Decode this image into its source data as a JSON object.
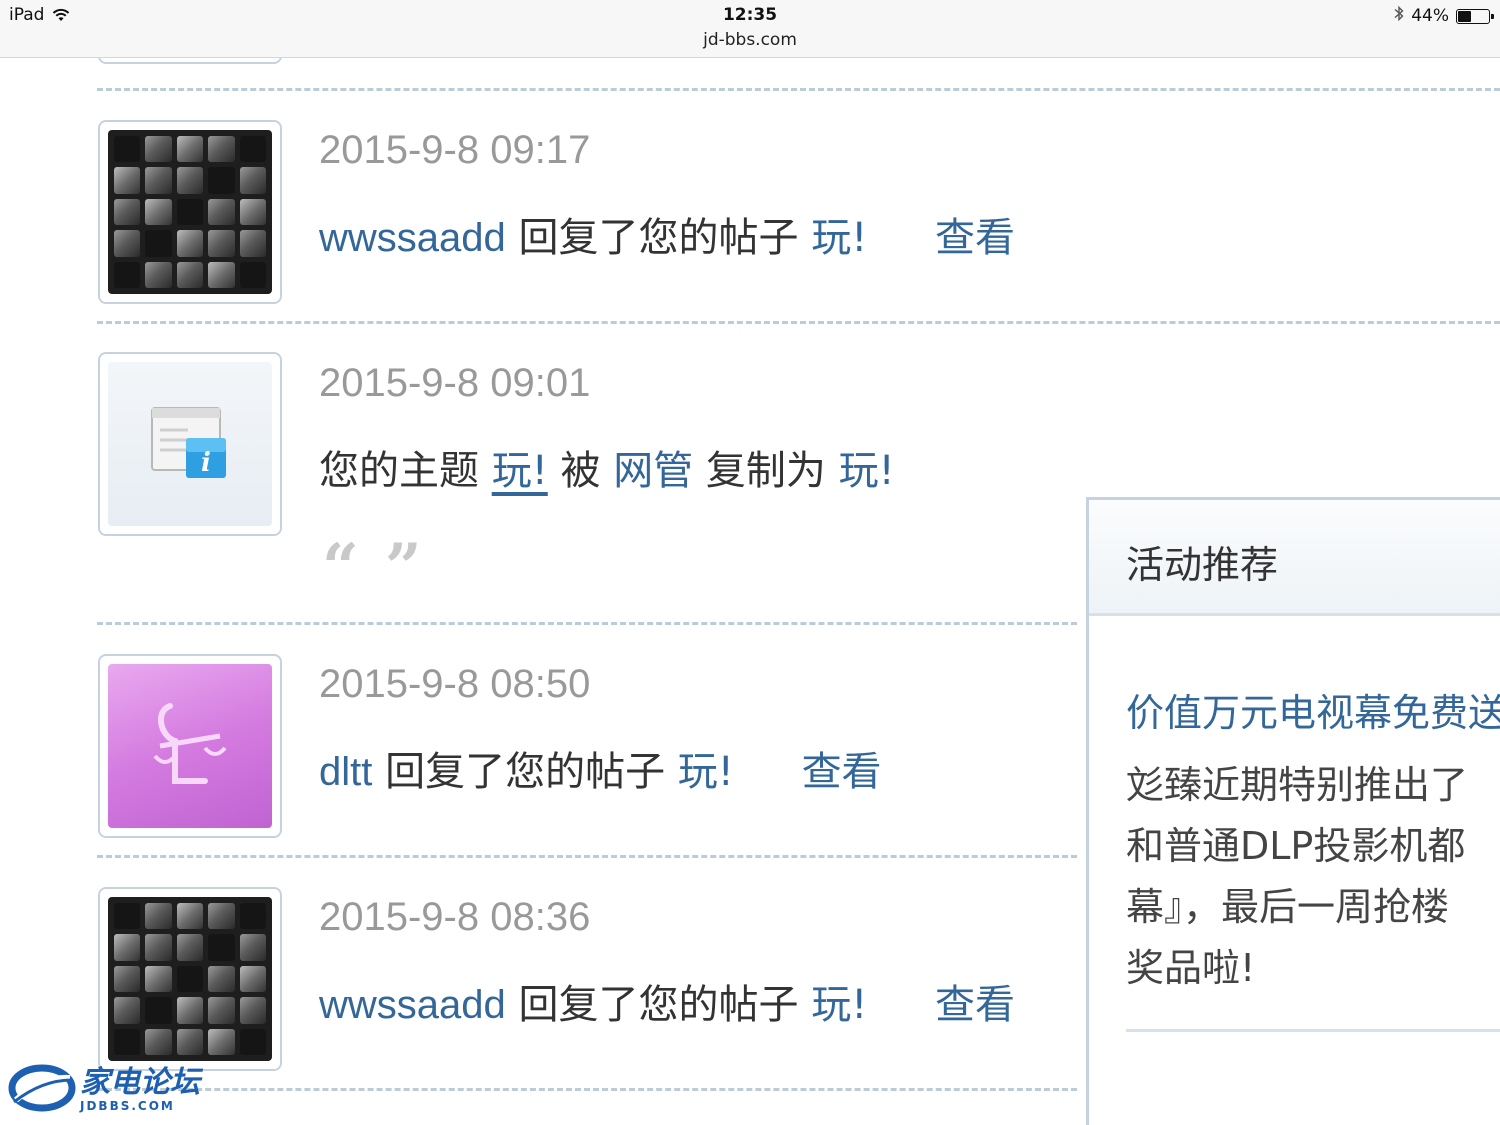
{
  "status_bar": {
    "device": "iPad",
    "time": "12:35",
    "url": "jd-bbs.com",
    "battery_percent": "44%",
    "battery_level": 0.44
  },
  "feed": [
    {
      "avatar": "keyboard-avatar",
      "time": "2015-9-8 09:17",
      "user": "wwssaadd",
      "action": "回复了您的帖子",
      "thread": "玩!",
      "view": "查看"
    },
    {
      "avatar": "system-notice-icon",
      "time": "2015-9-8 09:01",
      "prefix": "您的主题",
      "thread": "玩!",
      "middle": "被",
      "admin": "网管",
      "middle2": "复制为",
      "target": "玩!",
      "quote_open": "“",
      "quote_close": "”"
    },
    {
      "avatar": "libra-avatar",
      "time": "2015-9-8 08:50",
      "user": "dltt",
      "action": "回复了您的帖子",
      "thread": "玩!",
      "view": "查看"
    },
    {
      "avatar": "keyboard-avatar",
      "time": "2015-9-8 08:36",
      "user": "wwssaadd",
      "action": "回复了您的帖子",
      "thread": "玩!",
      "view": "查看"
    }
  ],
  "side_panel": {
    "title": "活动推荐",
    "link": "价值万元电视幕免费送",
    "lines": [
      "彣臻近期特别推出了",
      "和普通DLP投影机都",
      "幕』，最后一周抢楼",
      "奖品啦!"
    ]
  },
  "watermark": {
    "cn": "家电论坛",
    "en": "JDBBS.COM"
  },
  "colors": {
    "link": "#336699",
    "time": "#999999",
    "divider": "#bccbd8",
    "watermark": "#1d5fb0"
  }
}
